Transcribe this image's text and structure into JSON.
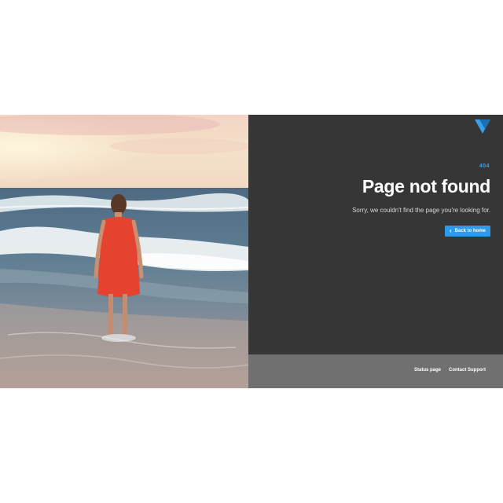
{
  "error": {
    "code": "404",
    "title": "Page not found",
    "message": "Sorry, we couldn't find the page you're looking for."
  },
  "back_button": {
    "label": "Back to home",
    "icon": "arrow-left-icon"
  },
  "footer": {
    "links": [
      {
        "label": "Contact Support"
      },
      {
        "label": "Status page"
      }
    ]
  },
  "colors": {
    "panel_bg": "#363636",
    "accent": "#2f9ae6",
    "footer_bg": "#707070"
  },
  "logo": {
    "icon": "triangle-logo-icon"
  }
}
